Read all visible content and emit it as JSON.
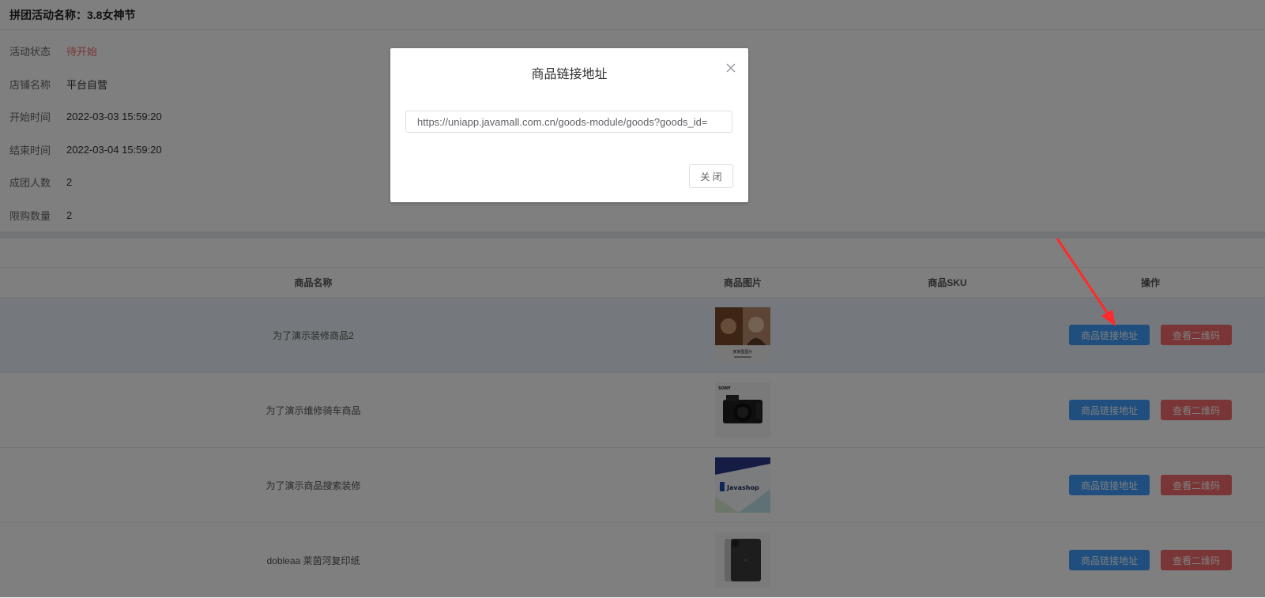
{
  "page": {
    "title": "拼团活动名称：3.8女神节"
  },
  "info": [
    {
      "label": "活动状态",
      "value": "待开始",
      "status": true
    },
    {
      "label": "店铺名称",
      "value": "平台自营"
    },
    {
      "label": "开始时间",
      "value": "2022-03-03 15:59:20"
    },
    {
      "label": "结束时间",
      "value": "2022-03-04 15:59:20"
    },
    {
      "label": "成团人数",
      "value": "2"
    },
    {
      "label": "限购数量",
      "value": "2"
    }
  ],
  "table": {
    "headers": {
      "name": "商品名称",
      "image": "商品图片",
      "sku": "商品SKU",
      "ops": "操作"
    },
    "rows": [
      {
        "name": "为了演示装修商品2",
        "image": "portrait-photo",
        "image_caption": "某某图图片",
        "sku": ""
      },
      {
        "name": "为了演示维修骑车商品",
        "image": "camera-photo",
        "image_brand": "SONY",
        "sku": ""
      },
      {
        "name": "为了演示商品搜索装修",
        "image": "javashop-logo",
        "image_brand": "Javashop",
        "sku": ""
      },
      {
        "name": "dobleaa 莱茵河复印纸",
        "image": "tablet-photo",
        "sku": ""
      }
    ],
    "btn_link": "商品链接地址",
    "btn_qr": "查看二维码"
  },
  "modal": {
    "title": "商品链接地址",
    "url": "https://uniapp.javamall.com.cn/goods-module/goods?goods_id=",
    "close_label": "关 闭"
  },
  "colors": {
    "primary": "#409eff",
    "danger": "#f56c6c",
    "annotation": "#ff2a2a"
  }
}
